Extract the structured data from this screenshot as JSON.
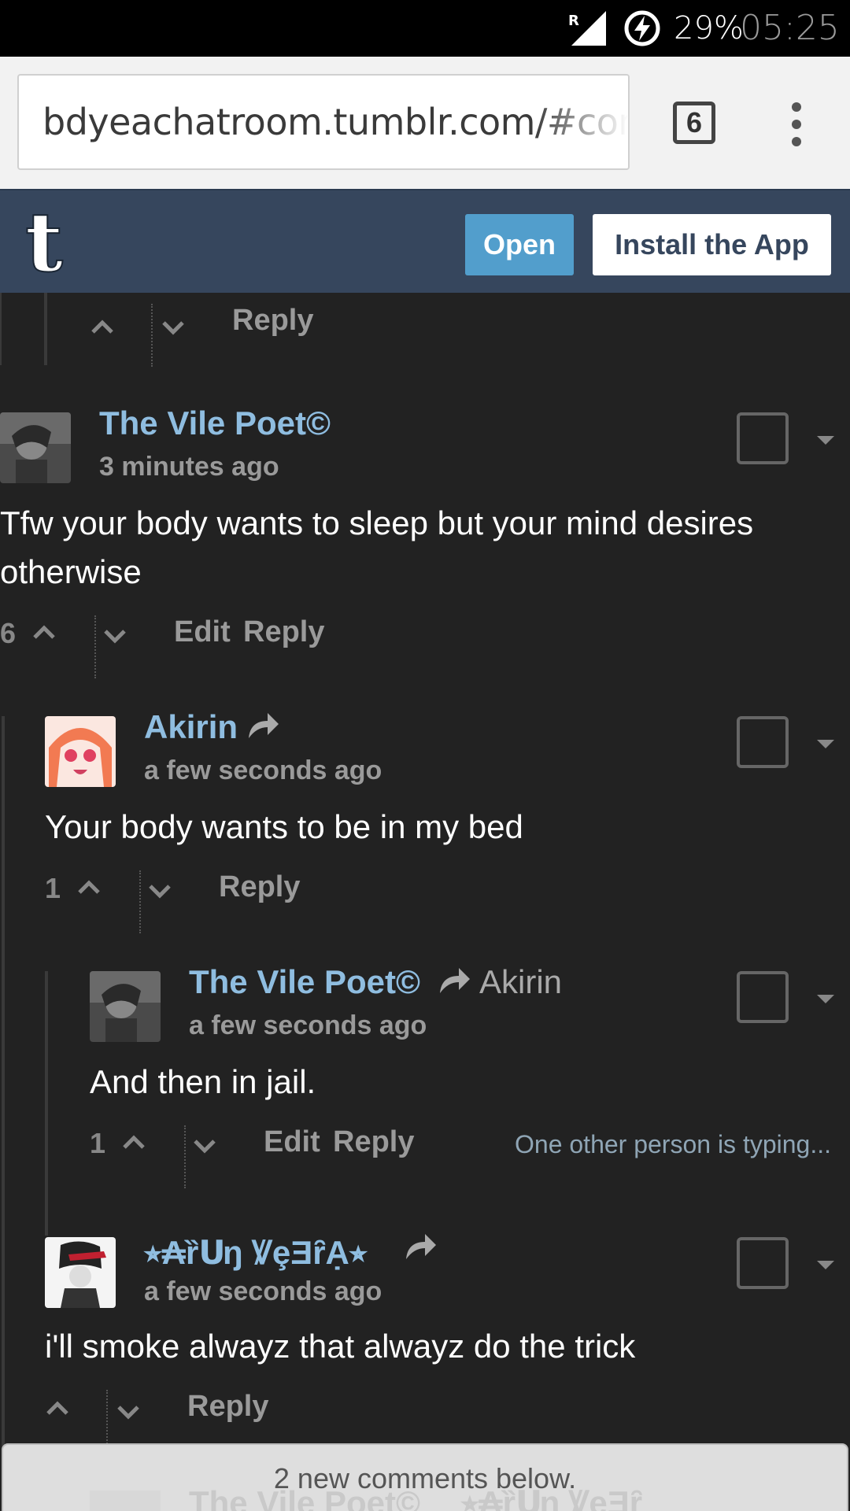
{
  "status_bar": {
    "network_label": "R",
    "battery_percent": "29%",
    "time": "05:25"
  },
  "browser": {
    "url": "bdyeachatroom.tumblr.com/#com",
    "tab_count": "6"
  },
  "tumblr_bar": {
    "logo_letter": "t",
    "open_label": "Open",
    "install_label": "Install the App"
  },
  "top_partial": {
    "reply_label": "Reply"
  },
  "comments": [
    {
      "author": "The Vile Poet©",
      "time": "3 minutes ago",
      "text": "Tfw your body wants to sleep but your mind desires otherwise",
      "votes": "6",
      "edit_label": "Edit",
      "reply_label": "Reply"
    },
    {
      "author": "Akirin",
      "time": "a few seconds ago",
      "text": "Your body wants to be in my bed",
      "votes": "1",
      "reply_label": "Reply"
    },
    {
      "author": "The Vile Poet©",
      "reply_to": "Akirin",
      "time": "a few seconds ago",
      "text": "And then in jail.",
      "votes": "1",
      "edit_label": "Edit",
      "reply_label": "Reply",
      "typing_notice": "One other person is typing..."
    },
    {
      "author": "⭒₳ȑՍŋ ꝞȩƎȓẠ⭒",
      "time": "a few seconds ago",
      "text": "i'll smoke alwayz that alwayz do the trick",
      "reply_label": "Reply"
    }
  ],
  "new_comments_banner": "2 new comments below.",
  "peek": {
    "author": "The Vile Poet©",
    "reply_to": "⭒₳ȑՍŋ ꝞȩƎȓ"
  },
  "colors": {
    "tumblr_blue": "#36465d",
    "open_button": "#529ecc",
    "author_link": "#8fbde0",
    "background": "#222222"
  }
}
